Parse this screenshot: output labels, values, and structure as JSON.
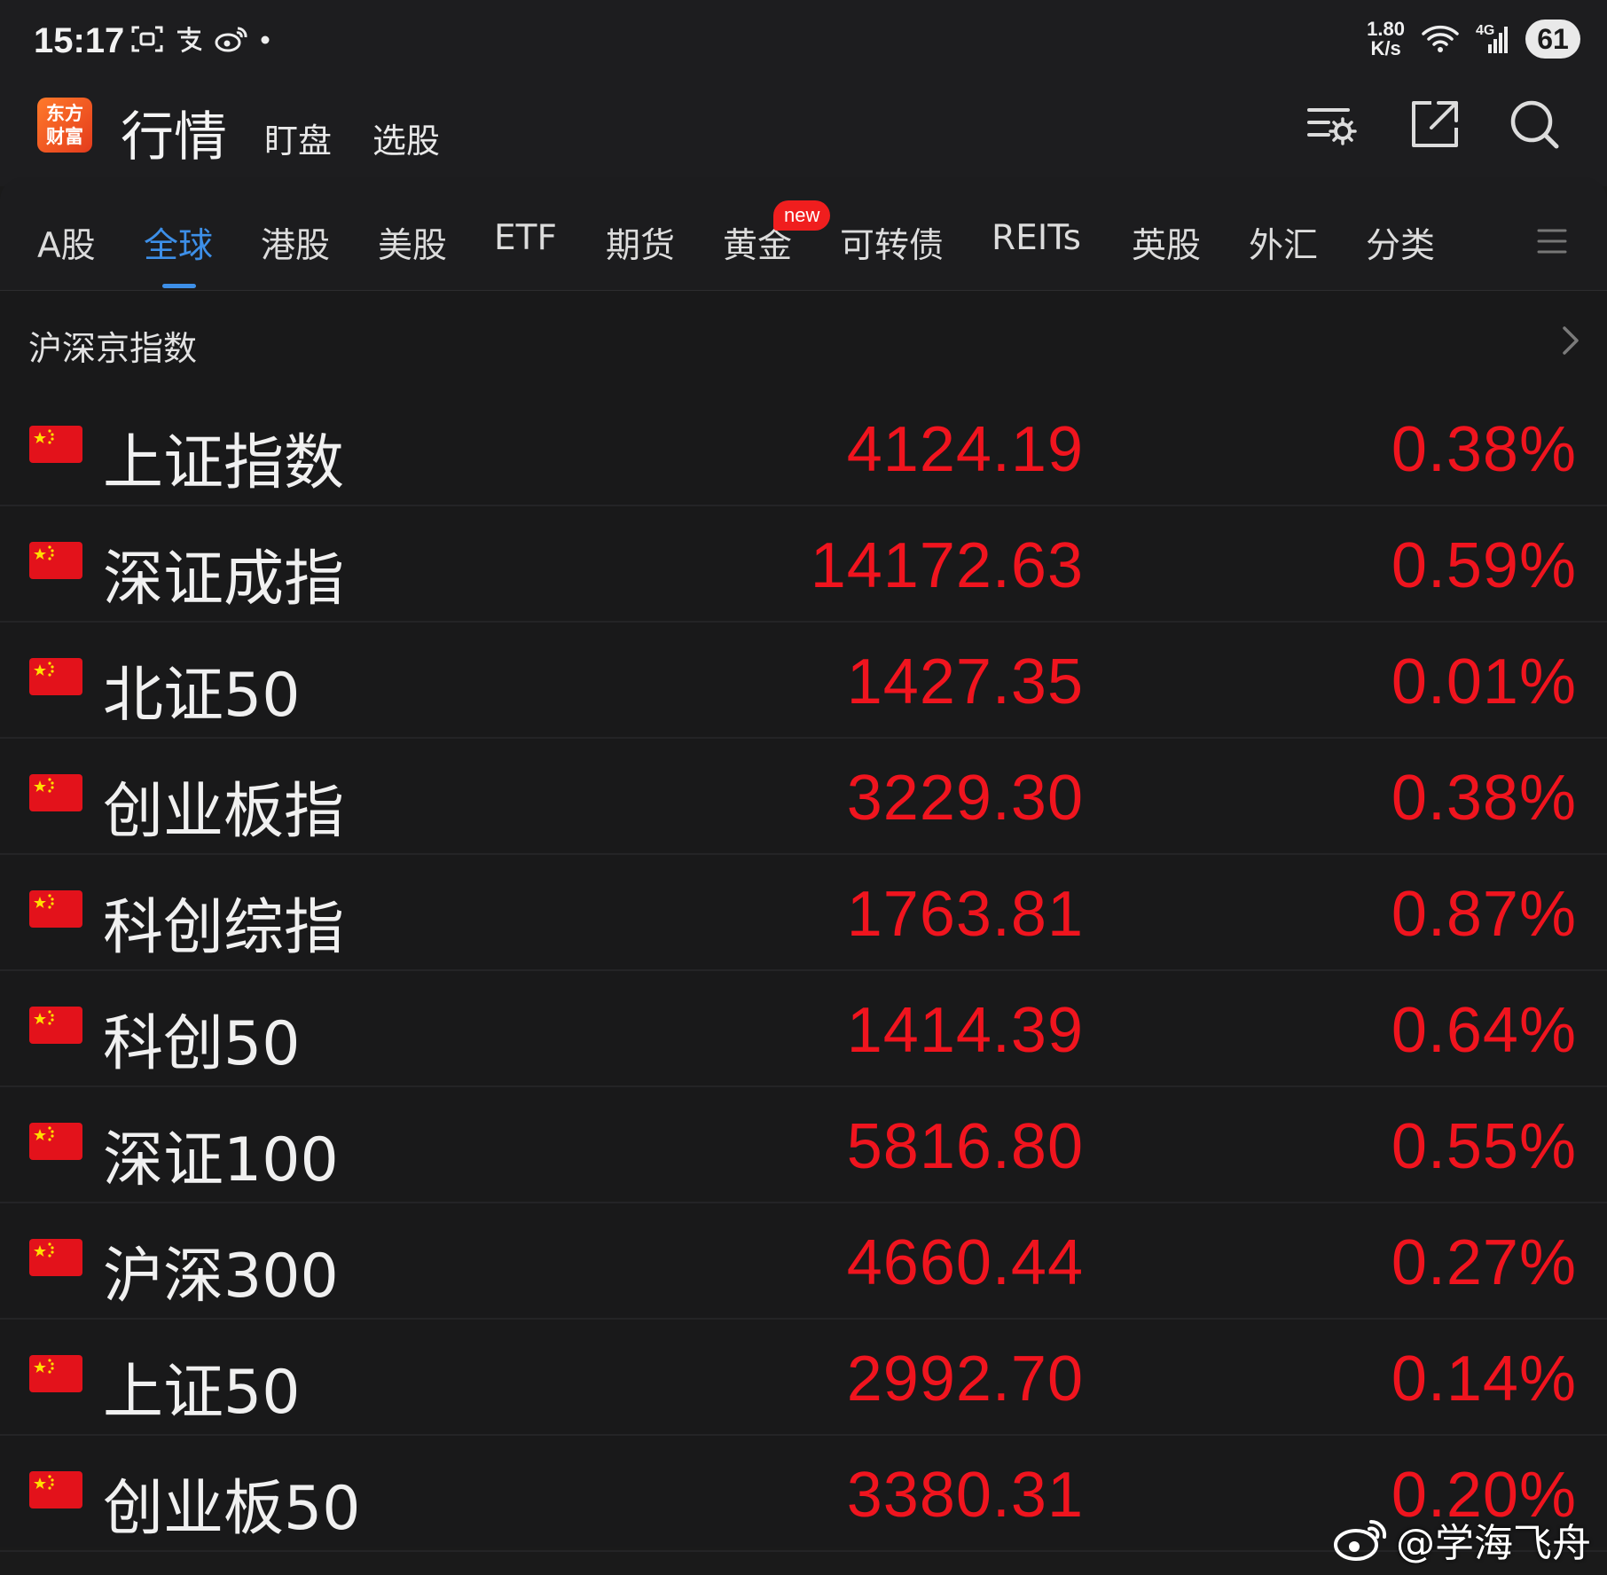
{
  "status_bar": {
    "time": "15:17",
    "net_speed_value": "1.80",
    "net_speed_unit": "K/s",
    "network": "4G",
    "battery": "61"
  },
  "header": {
    "logo_line1": "东方",
    "logo_line2": "财富",
    "title": "行情",
    "sub_tabs": [
      "盯盘",
      "选股"
    ]
  },
  "tabs": [
    {
      "label": "A股"
    },
    {
      "label": "全球",
      "active": true
    },
    {
      "label": "港股"
    },
    {
      "label": "美股"
    },
    {
      "label": "ETF"
    },
    {
      "label": "期货"
    },
    {
      "label": "黄金",
      "badge": "new"
    },
    {
      "label": "可转债"
    },
    {
      "label": "REITs"
    },
    {
      "label": "英股"
    },
    {
      "label": "外汇"
    },
    {
      "label": "分类"
    }
  ],
  "section": {
    "title": "沪深京指数"
  },
  "indices": [
    {
      "name": "上证指数",
      "price": "4124.19",
      "change": "0.38%"
    },
    {
      "name": "深证成指",
      "price": "14172.63",
      "change": "0.59%"
    },
    {
      "name": "北证50",
      "price": "1427.35",
      "change": "0.01%"
    },
    {
      "name": "创业板指",
      "price": "3229.30",
      "change": "0.38%"
    },
    {
      "name": "科创综指",
      "price": "1763.81",
      "change": "0.87%"
    },
    {
      "name": "科创50",
      "price": "1414.39",
      "change": "0.64%"
    },
    {
      "name": "深证100",
      "price": "5816.80",
      "change": "0.55%"
    },
    {
      "name": "沪深300",
      "price": "4660.44",
      "change": "0.27%"
    },
    {
      "name": "上证50",
      "price": "2992.70",
      "change": "0.14%"
    },
    {
      "name": "创业板50",
      "price": "3380.31",
      "change": "0.20%"
    }
  ],
  "colors": {
    "up": "#f0141e",
    "accent": "#3d8fe8",
    "background": "#1a1a1a"
  },
  "watermark": "@学海飞舟"
}
